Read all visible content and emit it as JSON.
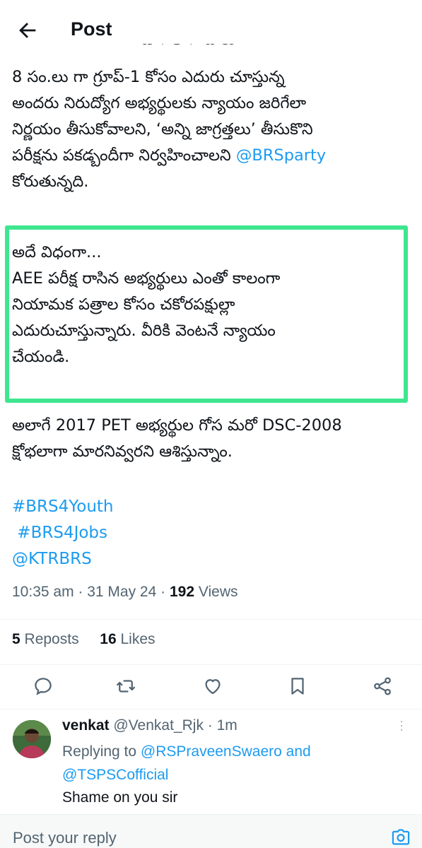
{
  "header": {
    "title": "Post",
    "back_icon": "arrow-left-icon"
  },
  "tweet": {
    "paragraph1": [
      "8 సం.లు గా గ్రూప్-1 కోసం ఎదురు చూస్తున్న",
      "అందరు నిరుద్యోగ అభ్యర్థులకు న్యాయం జరిగేలా",
      "నిర్ణయం తీసుకోవాలని, ‘అన్ని జాగ్రత్తలు’ తీసుకొని",
      "పరీక్షను పకడ్బందీగా నిర్వహించాలని "
    ],
    "paragraph1_mention": "@BRSparty",
    "paragraph1_end": "కోరుతున్నది.",
    "paragraph2": [
      "అదే విధంగా...",
      "AEE పరీక్ష రాసిన అభ్యర్థులు ఎంతో కాలంగా",
      "నియామక పత్రాల కోసం చకోరపక్షుల్లా",
      "ఎదురుచూస్తున్నారు. వీరికి వెంటనే న్యాయం",
      "చేయండి."
    ],
    "paragraph3": [
      "అలాగే 2017 PET అభ్యర్థుల గోస మరో DSC-2008",
      "క్షోభలాగా మారనివ్వరని ఆశిస్తున్నాం."
    ],
    "hashtags": [
      "#BRS4Youth",
      " #BRS4Jobs",
      "@KTRBRS"
    ],
    "time": "10:35 am",
    "date": "31 May 24",
    "views_count": "192",
    "views_label": "Views",
    "reposts_count": "5",
    "reposts_label": "Reposts",
    "likes_count": "16",
    "likes_label": "Likes",
    "highlight_color": "#3ee68f",
    "link_color": "#1d9bf0"
  },
  "actions": [
    "reply-icon",
    "repost-icon",
    "like-icon",
    "bookmark-icon",
    "share-icon"
  ],
  "reply": {
    "name": "venkat",
    "handle": "@Venkat_Rjk",
    "time": "1m",
    "replying_prefix": "Replying to ",
    "replying_user1": "@RSPraveenSwaero",
    "replying_and": " and",
    "replying_user2": "@TSPSCofficial",
    "text": "Shame on you sir"
  },
  "composer": {
    "placeholder": "Post your reply",
    "camera_icon": "camera-icon"
  }
}
